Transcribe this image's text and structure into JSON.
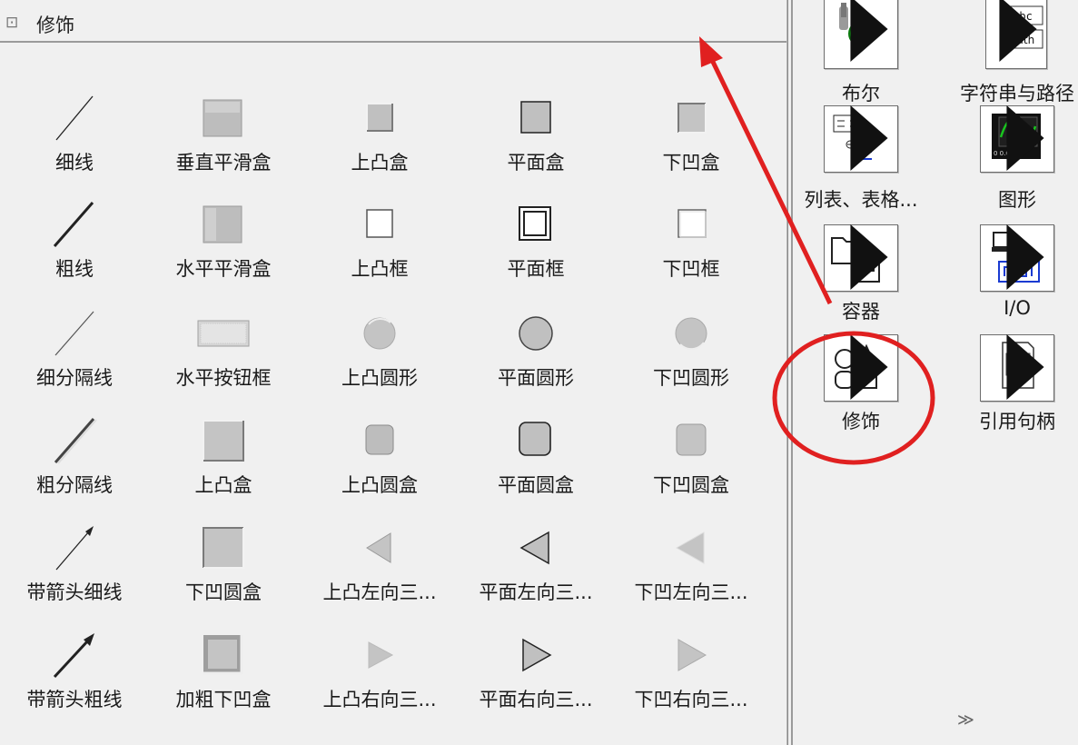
{
  "palette_title": "修饰",
  "title_glyph": "⊡",
  "accent_color": "#e02020",
  "decorations": [
    {
      "label": "细线",
      "icon": "thin-line-icon"
    },
    {
      "label": "垂直平滑盒",
      "icon": "vertical-smooth-box-icon"
    },
    {
      "label": "上凸盒",
      "icon": "raised-box-icon"
    },
    {
      "label": "平面盒",
      "icon": "flat-box-icon"
    },
    {
      "label": "下凹盒",
      "icon": "recessed-box-icon"
    },
    {
      "label": "粗线",
      "icon": "thick-line-icon"
    },
    {
      "label": "水平平滑盒",
      "icon": "horizontal-smooth-box-icon"
    },
    {
      "label": "上凸框",
      "icon": "raised-frame-icon"
    },
    {
      "label": "平面框",
      "icon": "flat-frame-icon"
    },
    {
      "label": "下凹框",
      "icon": "recessed-frame-icon"
    },
    {
      "label": "细分隔线",
      "icon": "thin-divider-icon"
    },
    {
      "label": "水平按钮框",
      "icon": "horizontal-button-box-icon"
    },
    {
      "label": "上凸圆形",
      "icon": "raised-circle-icon"
    },
    {
      "label": "平面圆形",
      "icon": "flat-circle-icon"
    },
    {
      "label": "下凹圆形",
      "icon": "recessed-circle-icon"
    },
    {
      "label": "粗分隔线",
      "icon": "thick-divider-icon"
    },
    {
      "label": "上凸盒",
      "icon": "raised-box-2-icon"
    },
    {
      "label": "上凸圆盒",
      "icon": "raised-rounded-box-icon"
    },
    {
      "label": "平面圆盒",
      "icon": "flat-rounded-box-icon"
    },
    {
      "label": "下凹圆盒",
      "icon": "recessed-rounded-box-icon"
    },
    {
      "label": "带箭头细线",
      "icon": "thin-arrow-line-icon"
    },
    {
      "label": "下凹圆盒",
      "icon": "recessed-rounded-box-2-icon"
    },
    {
      "label": "上凸左向三...",
      "icon": "raised-left-triangle-icon"
    },
    {
      "label": "平面左向三...",
      "icon": "flat-left-triangle-icon"
    },
    {
      "label": "下凹左向三...",
      "icon": "recessed-left-triangle-icon"
    },
    {
      "label": "带箭头粗线",
      "icon": "thick-arrow-line-icon"
    },
    {
      "label": "加粗下凹盒",
      "icon": "thick-recessed-box-icon"
    },
    {
      "label": "上凸右向三...",
      "icon": "raised-right-triangle-icon"
    },
    {
      "label": "平面右向三...",
      "icon": "flat-right-triangle-icon"
    },
    {
      "label": "下凹右向三...",
      "icon": "recessed-right-triangle-icon"
    }
  ],
  "categories": [
    {
      "label": "布尔",
      "icon": "boolean-icon"
    },
    {
      "label": "字符串与路径",
      "icon": "string-path-icon",
      "icon_text_1": "abc",
      "icon_text_2": "Path"
    },
    {
      "label": "列表、表格...",
      "icon": "list-table-icon"
    },
    {
      "label": "图形",
      "icon": "graph-icon"
    },
    {
      "label": "容器",
      "icon": "container-icon"
    },
    {
      "label": "I/O",
      "icon": "io-icon"
    },
    {
      "label": "修饰",
      "icon": "decorations-icon"
    },
    {
      "label": "引用句柄",
      "icon": "refnum-icon",
      "icon_text_1": "#"
    }
  ],
  "more_button": "≫"
}
